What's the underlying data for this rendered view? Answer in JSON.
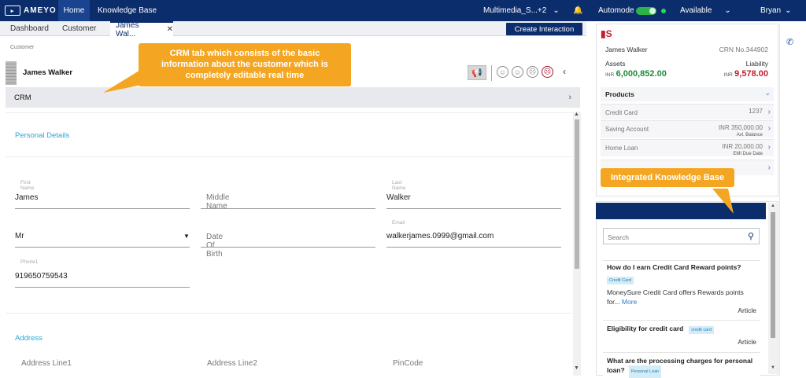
{
  "topbar": {
    "brand": "AMEYO",
    "nav_home": "Home",
    "nav_kb": "Knowledge Base",
    "campaign": "Multimedia_S...+2",
    "automode": "Automode",
    "status": "Available",
    "user": "Bryan"
  },
  "tabs": {
    "dashboard": "Dashboard",
    "customer": "Customer",
    "active": "James Wal...",
    "create_btn": "Create Interaction"
  },
  "customer": {
    "crumb": "Customer",
    "name": "James Walker",
    "crm_label": "CRM"
  },
  "personal": {
    "title": "Personal Details",
    "first_name_label": "First Name",
    "first_name": "James",
    "middle_name_ph": "Middle Name",
    "last_name_label": "Last Name",
    "last_name": "Walker",
    "title_value": "Mr",
    "dob_ph": "Date Of Birth",
    "email_label": "Email",
    "email": "walkerjames.0999@gmail.com",
    "phone_label": "Phone1",
    "phone": "919650759543"
  },
  "address": {
    "title": "Address",
    "line1_ph": "Address Line1",
    "line2_ph": "Address Line2",
    "pincode_ph": "PinCode"
  },
  "summary": {
    "name": "James Walker",
    "crn": "CRN No.344902",
    "assets_label": "Assets",
    "assets_currency": "INR",
    "assets_value": "6,000,852.00",
    "liability_label": "Liability",
    "liability_currency": "INR",
    "liability_value": "9,578.00",
    "products_label": "Products",
    "products": [
      {
        "name": "Credit Card",
        "value": "1237",
        "sub": ""
      },
      {
        "name": "Saving Account",
        "value": "INR 350,000.00",
        "sub": "Avl. Balance"
      },
      {
        "name": "Home Loan",
        "value": "INR 20,000.00",
        "sub": "EMI Due Date"
      }
    ]
  },
  "kb": {
    "search_ph": "Search",
    "articles": [
      {
        "title": "How do I earn Credit Card Reward points?",
        "tag": "Credit Card",
        "text": "MoneySure Credit Card offers Rewards points for...",
        "more": "More",
        "type": "Article"
      },
      {
        "title": "Eligibility for credit card",
        "tag": "credit card",
        "type": "Article"
      },
      {
        "title": "What are the processing charges for personal loan?",
        "tag": "Personal Loan"
      }
    ]
  },
  "callouts": {
    "crm": "CRM tab which consists of the basic information about the customer which is completely editable real time",
    "kb": "Integrated Knowledge Base"
  }
}
